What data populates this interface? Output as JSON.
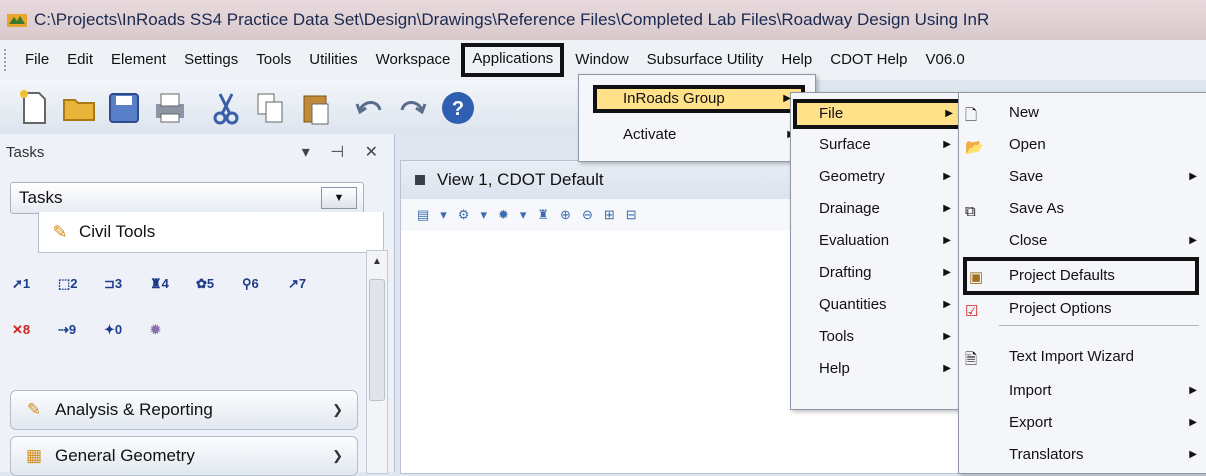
{
  "window": {
    "title": "C:\\Projects\\InRoads SS4 Practice Data Set\\Design\\Drawings\\Reference Files\\Completed Lab Files\\Roadway Design Using InR"
  },
  "menubar": {
    "items": [
      "File",
      "Edit",
      "Element",
      "Settings",
      "Tools",
      "Utilities",
      "Workspace",
      "Applications",
      "Window",
      "Subsurface Utility",
      "Help",
      "CDOT Help",
      "V06.0"
    ]
  },
  "tasks": {
    "header": "Tasks",
    "selector": "Tasks",
    "civil_tab": "Civil Tools",
    "tool_numbers": [
      "1",
      "2",
      "3",
      "4",
      "5",
      "6",
      "7",
      "8",
      "9",
      "0"
    ],
    "sections": [
      "Analysis & Reporting",
      "General Geometry"
    ]
  },
  "view": {
    "title": "View 1, CDOT Default"
  },
  "applications_menu": {
    "items": [
      "InRoads Group",
      "Activate"
    ]
  },
  "inroads_group_menu": {
    "items": [
      "File",
      "Surface",
      "Geometry",
      "Drainage",
      "Evaluation",
      "Drafting",
      "Quantities",
      "Tools",
      "Help"
    ]
  },
  "file_menu": {
    "items": [
      "New",
      "Open",
      "Save",
      "Save As",
      "Close",
      "Project Defaults",
      "Project Options",
      "Text Import Wizard",
      "Import",
      "Export",
      "Translators"
    ]
  },
  "colors": {
    "highlight": "#ffe18a",
    "annotation_box": "#111111",
    "title_text": "#1a2a50"
  }
}
